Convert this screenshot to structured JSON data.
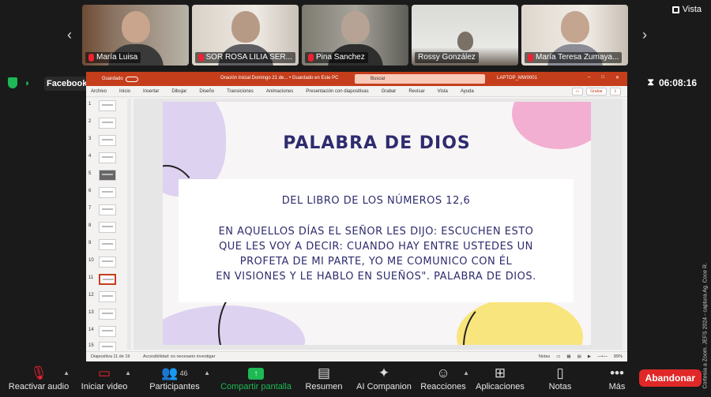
{
  "gallery": {
    "view_label": "Vista",
    "participants": [
      {
        "name": "María Luisa",
        "muted": true
      },
      {
        "name": "SOR ROSA LILIA SER...",
        "muted": true
      },
      {
        "name": "Pina Sanchez",
        "muted": true
      },
      {
        "name": "Rossy González",
        "muted": false
      },
      {
        "name": "María Teresa Zumaya...",
        "muted": true
      }
    ]
  },
  "status": {
    "stream_label": "Facebook",
    "timer": "06:08:16"
  },
  "powerpoint": {
    "autosave_label": "Guardado",
    "document_title": "Oración Inicial Domingo 21 de... • Guardado en Este PC",
    "search_placeholder": "Buscar",
    "user_label": "LAPTOP_MW0001",
    "record_label": "Grabar",
    "menu": [
      "Archivo",
      "Inicio",
      "Insertar",
      "Dibujar",
      "Diseño",
      "Transiciones",
      "Animaciones",
      "Presentación con diapositivas",
      "Grabar",
      "Revisar",
      "Vista",
      "Ayuda"
    ],
    "thumbnails": [
      "1",
      "2",
      "3",
      "4",
      "5",
      "6",
      "7",
      "8",
      "9",
      "10",
      "11",
      "12",
      "13",
      "14",
      "15"
    ],
    "active_slide": "11",
    "status_left": "Diapositiva 11 de 19",
    "status_middle": "Accesibilidad: es necesario investigar",
    "status_notes": "Notas",
    "zoom": "89%"
  },
  "slide": {
    "title": "PALABRA DE DIOS",
    "subtitle": "DEL LIBRO DE LOS NÚMEROS 12,6",
    "body_lines": [
      "EN AQUELLOS DÍAS EL SEÑOR LES DIJO: ESCUCHEN ESTO",
      "QUE LES VOY A DECIR: CUANDO HAY ENTRE USTEDES UN",
      "PROFETA DE MI PARTE, YO ME COMUNICO CON ÉL",
      "EN VISIONES Y LE HABLO EN SUEÑOS\". PALABRA DE DIOS."
    ]
  },
  "toolbar": {
    "audio": "Reactivar audio",
    "video": "Iniciar video",
    "participants": "Participantes",
    "participants_count": "46",
    "share": "Compartir pantalla",
    "summary": "Resumen",
    "companion": "AI Companion",
    "reactions": "Reacciones",
    "apps": "Aplicaciones",
    "notes": "Notas",
    "more": "Más",
    "leave": "Abandonar"
  },
  "watermark": "Cortesía a Zoom. JEFS 2024 - captura Ag. Coce R."
}
